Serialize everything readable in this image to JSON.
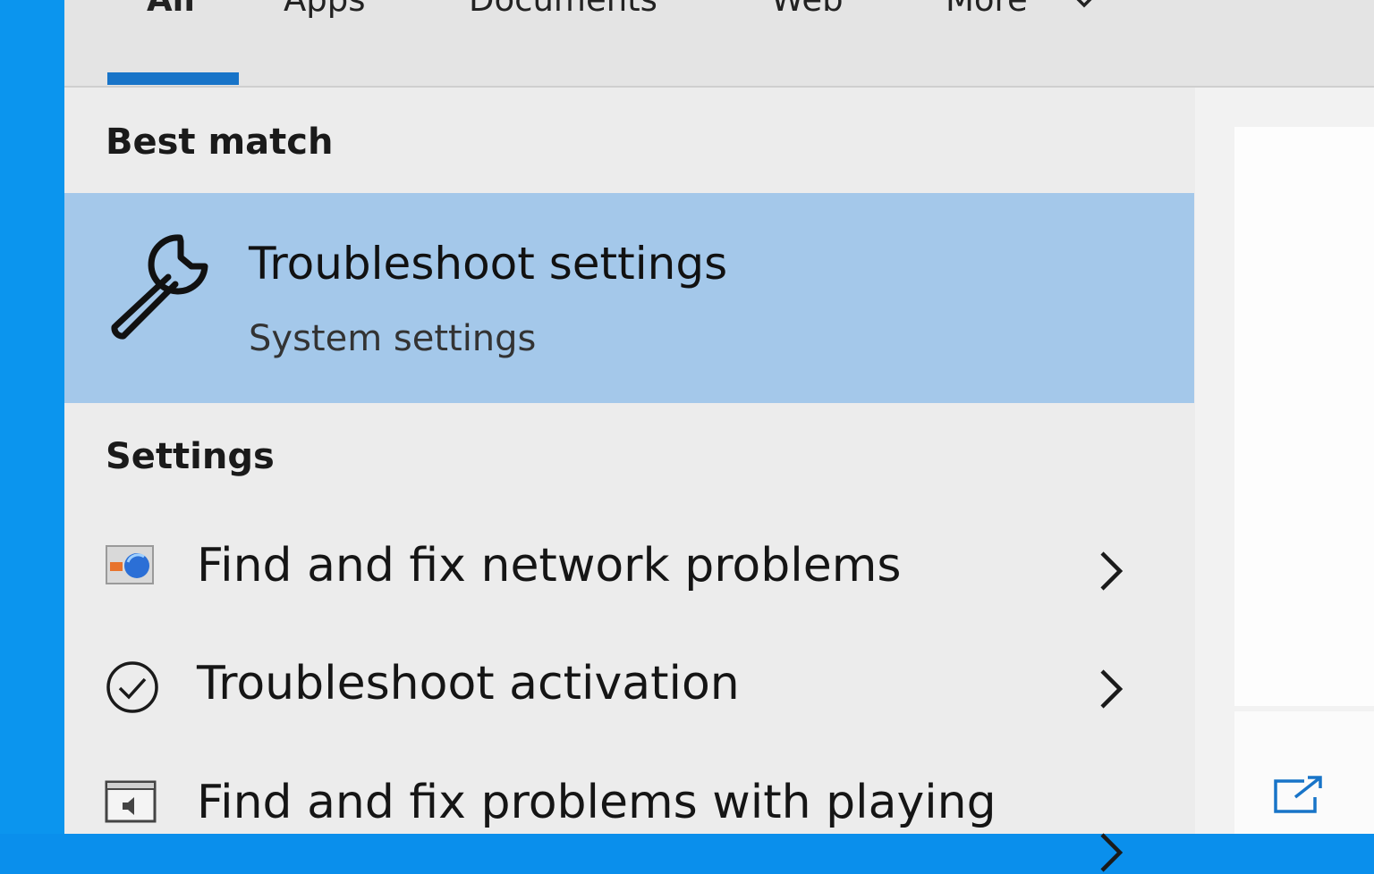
{
  "tabs": {
    "all": "All",
    "apps": "Apps",
    "documents": "Documents",
    "web": "Web",
    "more": "More"
  },
  "best_match": {
    "heading": "Best match",
    "title": "Troubleshoot settings",
    "subtitle": "System settings",
    "icon": "wrench-icon"
  },
  "settings": {
    "heading": "Settings",
    "items": [
      {
        "label": "Find and fix network problems",
        "icon": "network-troubleshooter-icon"
      },
      {
        "label": "Troubleshoot activation",
        "icon": "check-circle-icon"
      },
      {
        "label": "Find and fix problems with playing",
        "icon": "audio-troubleshooter-icon"
      }
    ]
  },
  "colors": {
    "accent": "#1874c8",
    "selected_bg": "#a4c8ea",
    "desktop": "#0b95ee"
  }
}
